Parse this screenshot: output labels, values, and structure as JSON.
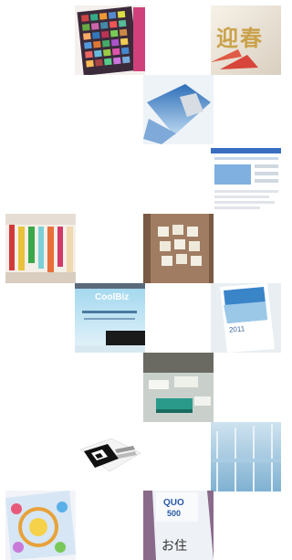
{
  "tiles": [
    {
      "name": "photo-collage-booklet",
      "row": 0,
      "col": 1
    },
    {
      "name": "new-year-card",
      "row": 0,
      "col": 3,
      "text": "迎春"
    },
    {
      "name": "sky-folded-card",
      "row": 1,
      "col": 2
    },
    {
      "name": "website-screenshot",
      "row": 2,
      "col": 3
    },
    {
      "name": "color-swatch-rack",
      "row": 3,
      "col": 0
    },
    {
      "name": "sticky-notes-on-board",
      "row": 3,
      "col": 2
    },
    {
      "name": "coolbiz-poster",
      "row": 4,
      "col": 1,
      "text": "CoolBiz"
    },
    {
      "name": "calendar-2011",
      "row": 4,
      "col": 3,
      "text": "2011"
    },
    {
      "name": "meeting-table-papers",
      "row": 5,
      "col": 2
    },
    {
      "name": "qr-code-card",
      "row": 6,
      "col": 1
    },
    {
      "name": "glass-partition-office",
      "row": 6,
      "col": 3
    },
    {
      "name": "colorful-brochure",
      "row": 7,
      "col": 0
    },
    {
      "name": "quo-card",
      "row": 7,
      "col": 2,
      "text": "QUO",
      "value": "500",
      "footer": "お住"
    }
  ]
}
